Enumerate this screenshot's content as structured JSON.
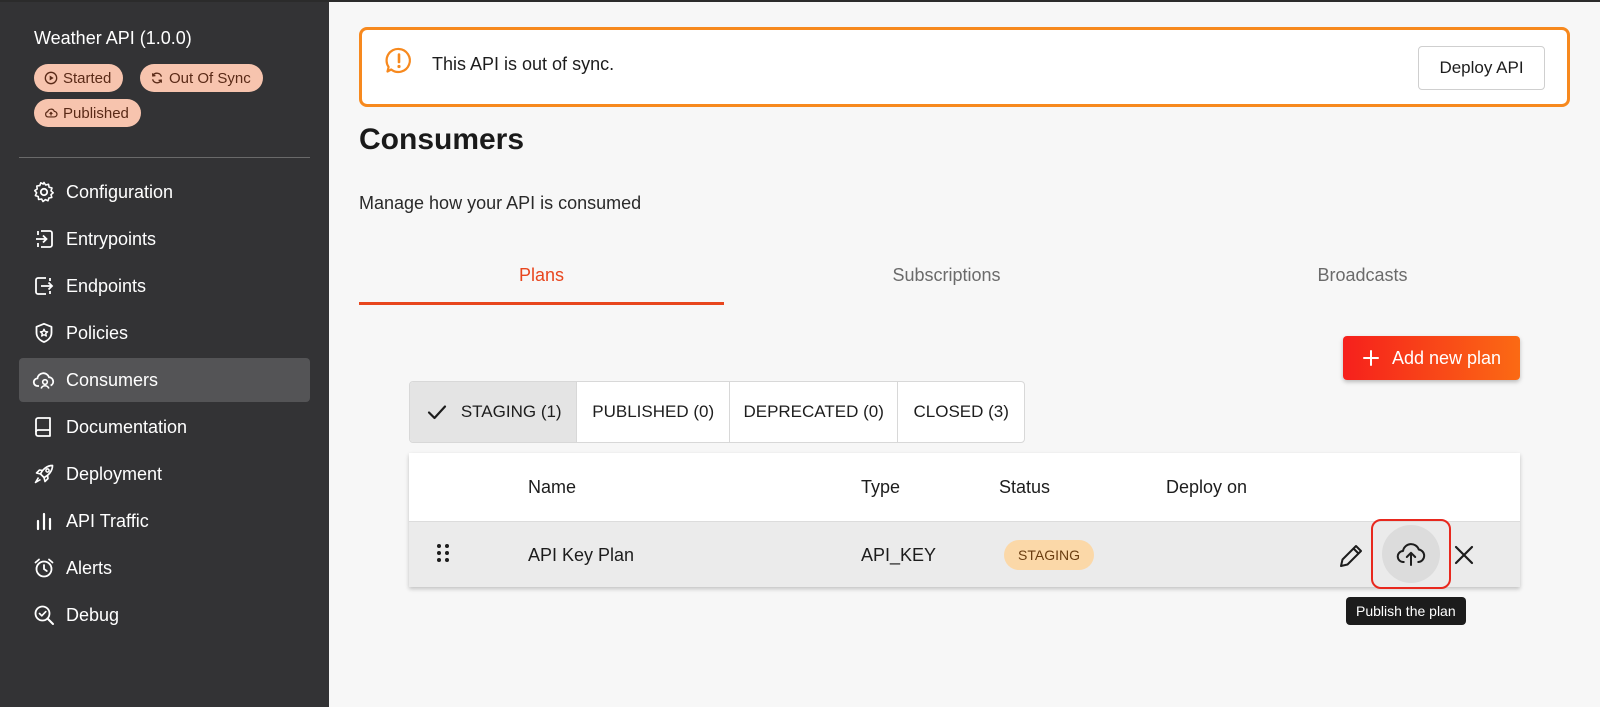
{
  "sidebar": {
    "api_title": "Weather API (1.0.0)",
    "badges": [
      {
        "label": "Started",
        "icon": "play-circle-icon"
      },
      {
        "label": "Out Of Sync",
        "icon": "sync-icon"
      },
      {
        "label": "Published",
        "icon": "cloud-upload-icon"
      }
    ],
    "items": [
      {
        "label": "Configuration",
        "icon": "gear-icon"
      },
      {
        "label": "Entrypoints",
        "icon": "entrypoint-icon"
      },
      {
        "label": "Endpoints",
        "icon": "endpoint-icon"
      },
      {
        "label": "Policies",
        "icon": "shield-icon"
      },
      {
        "label": "Consumers",
        "icon": "cloud-user-icon",
        "active": true
      },
      {
        "label": "Documentation",
        "icon": "book-icon"
      },
      {
        "label": "Deployment",
        "icon": "rocket-icon"
      },
      {
        "label": "API Traffic",
        "icon": "bar-chart-icon"
      },
      {
        "label": "Alerts",
        "icon": "alarm-icon"
      },
      {
        "label": "Debug",
        "icon": "search-bug-icon"
      }
    ]
  },
  "banner": {
    "message": "This API is out of sync.",
    "deploy_label": "Deploy API"
  },
  "page": {
    "title": "Consumers",
    "subtitle": "Manage how your API is consumed"
  },
  "tabs": [
    {
      "label": "Plans",
      "active": true
    },
    {
      "label": "Subscriptions"
    },
    {
      "label": "Broadcasts"
    }
  ],
  "add_plan_label": "Add new plan",
  "filters": [
    {
      "label": "STAGING (1)",
      "active": true
    },
    {
      "label": "PUBLISHED (0)"
    },
    {
      "label": "DEPRECATED (0)"
    },
    {
      "label": "CLOSED (3)"
    }
  ],
  "table": {
    "columns": [
      "Name",
      "Type",
      "Status",
      "Deploy on"
    ],
    "rows": [
      {
        "name": "API Key Plan",
        "type": "API_KEY",
        "status": "STAGING",
        "deploy_on": ""
      }
    ]
  },
  "tooltip": "Publish the plan",
  "colors": {
    "accent": "#e8461e",
    "warning_border": "#f7891e",
    "sidebar_bg": "#333335",
    "badge_bg": "#f7c4ae",
    "status_staging_bg": "#fbd8a8"
  }
}
